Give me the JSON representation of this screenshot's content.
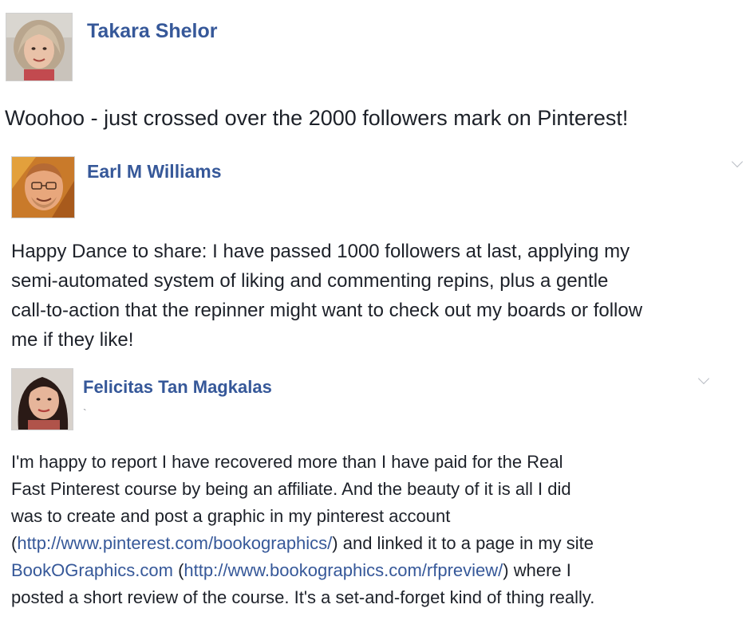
{
  "posts": [
    {
      "author": "Takara Shelor",
      "avatar_icon": "profile-photo",
      "text": "Woohoo - just crossed over the 2000 followers mark on Pinterest!"
    },
    {
      "author": "Earl M Williams",
      "avatar_icon": "profile-photo",
      "menu_icon": "chevron-down-icon",
      "text": "Happy Dance to share: I have passed 1000 followers at last, applying my\nsemi-automated system of liking and commenting repins, plus a gentle\ncall-to-action that the repinner might want to check out my boards or follow\nme if they like!"
    },
    {
      "author": "Felicitas Tan Magkalas",
      "avatar_icon": "profile-photo",
      "menu_icon": "chevron-down-icon",
      "tick": "`",
      "text_parts": {
        "line1": "I'm happy to report I have recovered more than I have paid for the Real",
        "line2": "Fast Pinterest course by being an affiliate. And the beauty of it is all I did",
        "line3": "was to create and post a graphic in my pinterest account",
        "paren_open": "(",
        "link1": "http://www.pinterest.com/bookographics/",
        "after_link1": ") and linked it to a page in my site",
        "link2": "BookOGraphics.com",
        "space_paren": " (",
        "link3": "http://www.bookographics.com/rfpreview/",
        "after_link3": ") where I",
        "line6": "posted a short review of the course. It's a set-and-forget kind of thing really."
      }
    }
  ],
  "colors": {
    "author_link": "#365899",
    "text": "#1d2129",
    "chevron": "#b8bcc4"
  }
}
